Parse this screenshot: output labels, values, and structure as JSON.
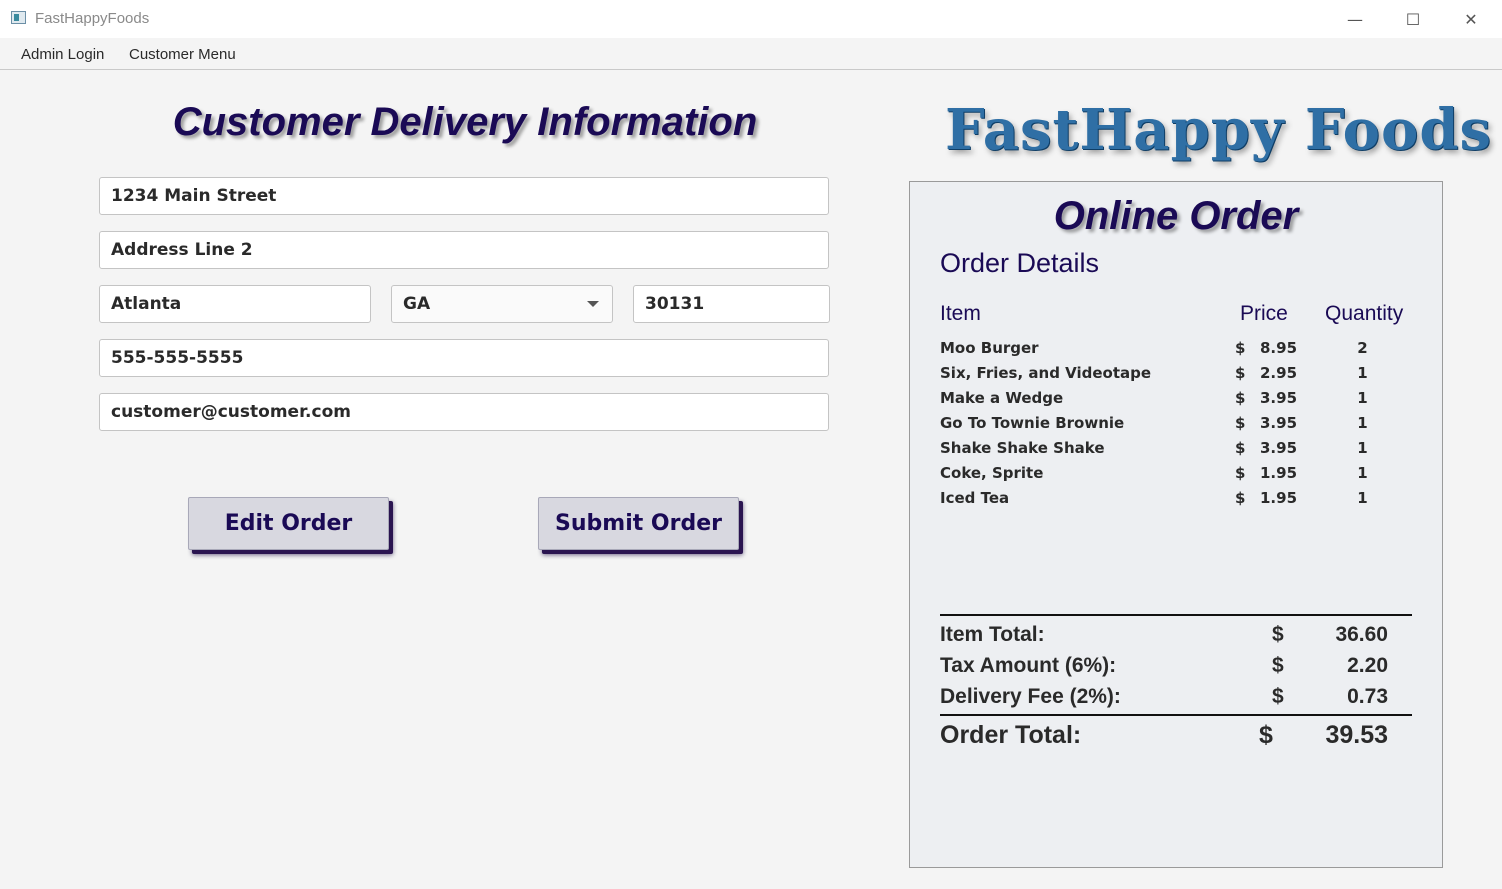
{
  "window": {
    "title": "FastHappyFoods",
    "minimize_glyph": "—",
    "maximize_glyph": "☐",
    "close_glyph": "✕"
  },
  "menu": {
    "items": [
      "Admin Login",
      "Customer Menu"
    ]
  },
  "form": {
    "title": "Customer Delivery Information",
    "address_line1": "1234 Main Street",
    "address_line2": "Address Line 2",
    "city": "Atlanta",
    "state": "GA",
    "zip": "30131",
    "phone": "555-555-5555",
    "email": "customer@customer.com",
    "edit_button": "Edit Order",
    "submit_button": "Submit Order"
  },
  "logo": {
    "text": "FastHappy Foods",
    "color": "#2f6fa5"
  },
  "order": {
    "title": "Online Order",
    "details_title": "Order Details",
    "headers": {
      "item": "Item",
      "price": "Price",
      "quantity": "Quantity"
    },
    "items": [
      {
        "name": "Moo Burger",
        "currency": "$",
        "price": "8.95",
        "qty": "2"
      },
      {
        "name": "Six, Fries, and Videotape",
        "currency": "$",
        "price": "2.95",
        "qty": "1"
      },
      {
        "name": "Make a Wedge",
        "currency": "$",
        "price": "3.95",
        "qty": "1"
      },
      {
        "name": "Go To Townie Brownie",
        "currency": "$",
        "price": "3.95",
        "qty": "1"
      },
      {
        "name": "Shake Shake Shake",
        "currency": "$",
        "price": "3.95",
        "qty": "1"
      },
      {
        "name": "Coke, Sprite",
        "currency": "$",
        "price": "1.95",
        "qty": "1"
      },
      {
        "name": "Iced Tea",
        "currency": "$",
        "price": "1.95",
        "qty": "1"
      }
    ],
    "summary": {
      "item_total_label": "Item Total:",
      "item_total_currency": "$",
      "item_total_value": "36.60",
      "tax_label": "Tax Amount (6%):",
      "tax_currency": "$",
      "tax_value": "2.20",
      "delivery_label": "Delivery Fee (2%):",
      "delivery_currency": "$",
      "delivery_value": "0.73",
      "order_total_label": "Order Total:",
      "order_total_currency": "$",
      "order_total_value": "39.53"
    }
  },
  "colors": {
    "accent": "#1a0a55",
    "panel_bg": "#edeff2",
    "button_bg": "#d8d8e0"
  }
}
